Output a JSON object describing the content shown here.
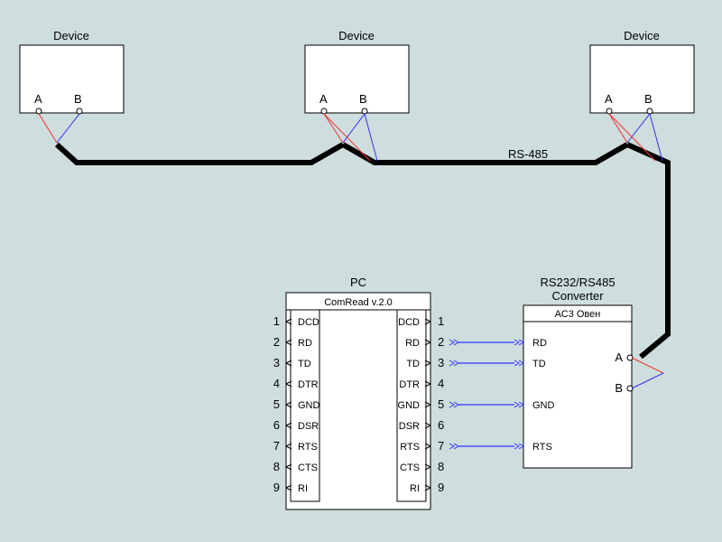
{
  "bus_label": "RS-485",
  "devices": [
    {
      "title": "Device",
      "portA": "A",
      "portB": "B"
    },
    {
      "title": "Device",
      "portA": "A",
      "portB": "B"
    },
    {
      "title": "Device",
      "portA": "A",
      "portB": "B"
    }
  ],
  "pc": {
    "title": "PC",
    "subtitle": "ComRead v.2.0",
    "left_pins": [
      "1",
      "2",
      "3",
      "4",
      "5",
      "6",
      "7",
      "8",
      "9"
    ],
    "right_pins": [
      "1",
      "2",
      "3",
      "4",
      "5",
      "6",
      "7",
      "8",
      "9"
    ],
    "signals": [
      "DCD",
      "RD",
      "TD",
      "DTR",
      "GND",
      "DSR",
      "RTS",
      "CTS",
      "RI"
    ]
  },
  "converter": {
    "title": "RS232/RS485\nConverter",
    "subtitle": "АС3 Овен",
    "left_signals": [
      "RD",
      "TD",
      "GND",
      "RTS"
    ],
    "right_ports": [
      "A",
      "B"
    ]
  },
  "cable_links": [
    2,
    3,
    5,
    7
  ]
}
